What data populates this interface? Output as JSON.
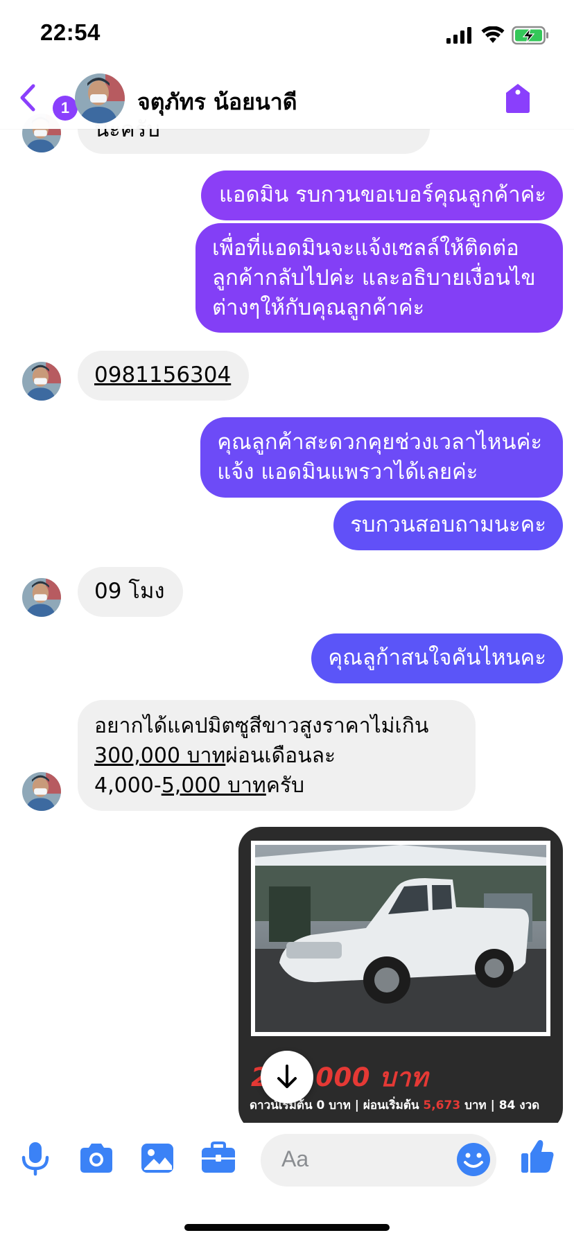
{
  "status_bar": {
    "time": "22:54"
  },
  "header": {
    "unread_count": "1",
    "contact_name": "จตุภัทร น้อยนาดี"
  },
  "messages": [
    {
      "side": "in",
      "text": "นะครับ"
    },
    {
      "side": "out",
      "text": "แอดมิน รบกวนขอเบอร์คุณลูกค้าค่ะ"
    },
    {
      "side": "out",
      "lines": [
        "เพื่อที่แอดมินจะแจ้งเซลล์ให้ติดต่อ",
        "ลูกค้ากลับไปค่ะ และอธิบายเงื่อนไข",
        "ต่างๆให้กับคุณลูกค้าค่ะ"
      ]
    },
    {
      "side": "in",
      "text": "0981156304"
    },
    {
      "side": "out",
      "lines": [
        "คุณลูกค้าสะดวกคุยช่วงเวลาไหนค่ะ",
        "แจ้ง แอดมินแพรวาได้เลยค่ะ"
      ]
    },
    {
      "side": "out",
      "text": "รบกวนสอบถามนะคะ"
    },
    {
      "side": "in",
      "text": "09 โมง"
    },
    {
      "side": "out",
      "text": "คุณลูก้าสนใจคันไหนคะ"
    },
    {
      "side": "in",
      "line1": "อยากได้แคปมิตซูสีขาวสูงราคาไม่เกิน",
      "line2_link": "300,000 บาท",
      "line2_rest": "ผ่อนเดือนละ",
      "line3_pre": "4,000-",
      "line3_link": "5,000 บาท",
      "line3_rest": "ครับ"
    }
  ],
  "car_card": {
    "price": "299,000 บาท",
    "down_label": "ดาวน์เริ่มต้น",
    "down_value": "0",
    "unit": "บาท",
    "installment_label": "ผ่อนเริ่มต้น",
    "installment_value": "5,673",
    "term": "84 งวด",
    "sep": "|"
  },
  "composer": {
    "placeholder": "Aa"
  },
  "colors": {
    "accent": "#8a3ffc",
    "bubble_in": "#f0f0f0",
    "bubble_out_top": "#8b3ff6",
    "bubble_out_bottom": "#5b55f8",
    "composer_icons": "#3b82f6"
  }
}
